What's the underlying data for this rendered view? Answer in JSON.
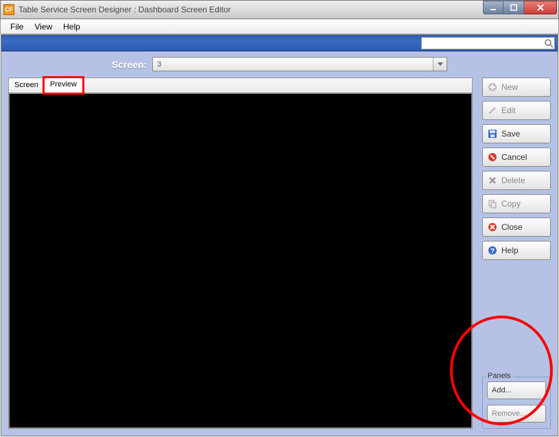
{
  "window": {
    "title": "Table Service Screen Designer : Dashboard Screen Editor"
  },
  "menu": {
    "file": "File",
    "view": "View",
    "help": "Help"
  },
  "search": {
    "placeholder": ""
  },
  "screen": {
    "label": "Screen:",
    "value": "3"
  },
  "tabs": {
    "screen": "Screen",
    "preview": "Preview",
    "active": "preview"
  },
  "buttons": {
    "new": "New",
    "edit": "Edit",
    "save": "Save",
    "cancel": "Cancel",
    "delete": "Delete",
    "copy": "Copy",
    "close": "Close",
    "help": "Help"
  },
  "panels": {
    "title": "Panels",
    "add": "Add...",
    "remove": "Remove..."
  }
}
